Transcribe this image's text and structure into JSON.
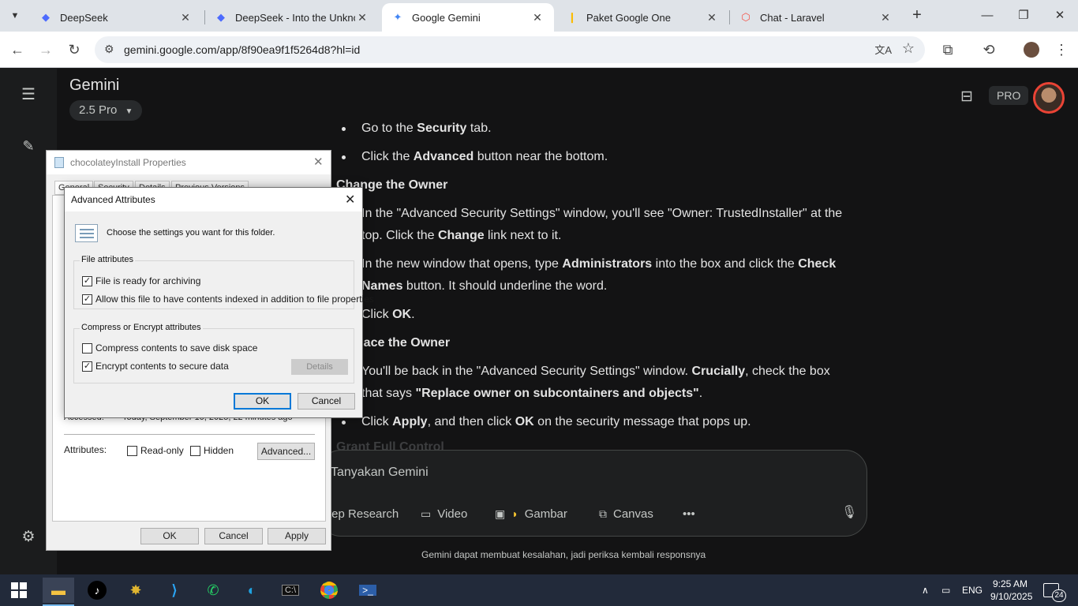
{
  "browser": {
    "tabs": [
      {
        "title": "DeepSeek",
        "favicon": "deepseek-icon",
        "color": "#4d6bfe"
      },
      {
        "title": "DeepSeek - Into the Unknown",
        "favicon": "deepseek-icon",
        "color": "#4d6bfe"
      },
      {
        "title": "Google Gemini",
        "favicon": "gemini-icon",
        "color": "#4285f4",
        "active": true
      },
      {
        "title": "Paket Google One",
        "favicon": "google-one-icon",
        "color": "#fbbc04"
      },
      {
        "title": "Chat - Laravel",
        "favicon": "laravel-icon",
        "color": "#f55247"
      }
    ],
    "url": "gemini.google.com/app/8f90ea9f1f5264d8?hl=id"
  },
  "gemini": {
    "title": "Gemini",
    "model": "2.5 Pro",
    "pro_badge": "PRO",
    "content": {
      "b1": {
        "pre": "Go to the ",
        "bold": "Security",
        "post": " tab."
      },
      "b2": {
        "pre": "Click the ",
        "bold": "Advanced",
        "post": " button near the bottom."
      },
      "h1": "Change the Owner",
      "b3": {
        "l1a": "In the \"Advanced Security Settings\" window, you'll see \"Owner: TrustedInstaller\" at the",
        "l2a": "top. Click the ",
        "l2b": "Change",
        "l2c": " link next to it."
      },
      "b4": {
        "l1a": "In the new window that opens, type ",
        "l1b": "Administrators",
        "l1c": " into the box and click the ",
        "l1d": "Check",
        "l2a": "Names",
        "l2b": " button. It should underline the word."
      },
      "b5": {
        "pre": "Click ",
        "bold": "OK",
        "post": "."
      },
      "h2": "Replace the Owner",
      "b6": {
        "l1a": "You'll be back in the \"Advanced Security Settings\" window. ",
        "l1b": "Crucially",
        "l1c": ", check the box",
        "l2a": "that says ",
        "l2b": "\"Replace owner on subcontainers and objects\"",
        "l2c": "."
      },
      "b7": {
        "a": "Click ",
        "b": "Apply",
        "c": ", and then click ",
        "d": "OK",
        "e": " on the security message that pops up."
      },
      "h3": "Grant Full Control"
    },
    "composer": {
      "placeholder": "Tanyakan Gemini",
      "tools": [
        "Deep Research",
        "Video",
        "Gambar",
        "Canvas"
      ]
    },
    "disclaimer": "Gemini dapat membuat kesalahan, jadi periksa kembali responsnya"
  },
  "props_dialog": {
    "title": "chocolateyInstall Properties",
    "tabs": [
      "General",
      "Security",
      "Details",
      "Previous Versions"
    ],
    "accessed_label": "Accessed:",
    "accessed_value": "Today, September 10, 2025, 22 minutes ago",
    "attributes_label": "Attributes:",
    "readonly_label": "Read-only",
    "hidden_label": "Hidden",
    "advanced_btn": "Advanced...",
    "ok": "OK",
    "cancel": "Cancel",
    "apply": "Apply"
  },
  "adv_dialog": {
    "title": "Advanced Attributes",
    "intro": "Choose the settings you want for this folder.",
    "file_attr_group": "File attributes",
    "archive_label": "File is ready for archiving",
    "archive_checked": true,
    "index_label": "Allow this file to have contents indexed in addition to file properties",
    "index_checked": true,
    "compress_group": "Compress or Encrypt attributes",
    "compress_label": "Compress contents to save disk space",
    "compress_checked": false,
    "encrypt_label": "Encrypt contents to secure data",
    "encrypt_checked": true,
    "details_btn": "Details",
    "ok": "OK",
    "cancel": "Cancel"
  },
  "taskbar": {
    "language": "ENG",
    "time": "9:25 AM",
    "date": "9/10/2025",
    "notifications": "24"
  }
}
